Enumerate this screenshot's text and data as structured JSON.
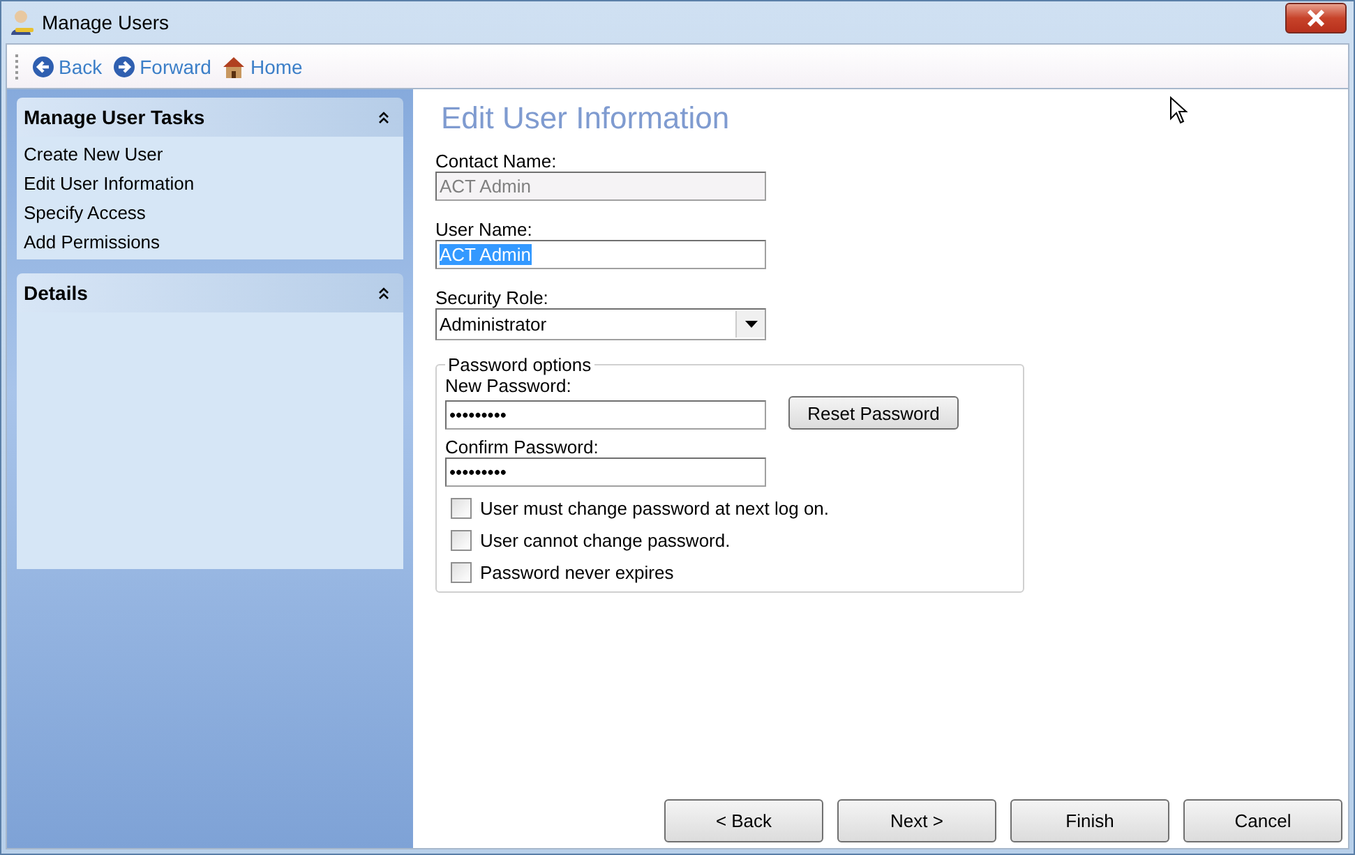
{
  "window": {
    "title": "Manage Users"
  },
  "toolbar": [
    {
      "kind": "back",
      "label": "Back"
    },
    {
      "kind": "forward",
      "label": "Forward"
    },
    {
      "kind": "home",
      "label": "Home"
    }
  ],
  "sidebar": [
    {
      "title": "Manage User Tasks",
      "expanded": true,
      "items": [
        "Create New User",
        "Edit User Information",
        "Specify Access",
        "Add Permissions"
      ]
    },
    {
      "title": "Details",
      "expanded": true
    }
  ],
  "form": {
    "heading": "Edit User Information",
    "contact_name": {
      "label": "Contact Name:",
      "value": "ACT Admin",
      "disabled": true
    },
    "user_name": {
      "label": "User Name:",
      "value": "ACT Admin",
      "selected": true
    },
    "security_role": {
      "label": "Security Role:",
      "value": "Administrator"
    },
    "password_options": {
      "title": "Password options",
      "new_password": {
        "label": "New Password:",
        "value": "•••••••••"
      },
      "confirm_password": {
        "label": "Confirm Password:",
        "value": "•••••••••"
      },
      "reset_button": {
        "label": "Reset Password"
      },
      "checkboxes": [
        {
          "label": "User must change password at next log on.",
          "checked": false
        },
        {
          "label": "User cannot change password.",
          "checked": false
        },
        {
          "label": "Password never expires",
          "checked": false
        }
      ]
    }
  },
  "buttons": [
    {
      "label": "< Back"
    },
    {
      "label": "Next >"
    },
    {
      "label": "Finish"
    },
    {
      "label": "Cancel"
    }
  ]
}
